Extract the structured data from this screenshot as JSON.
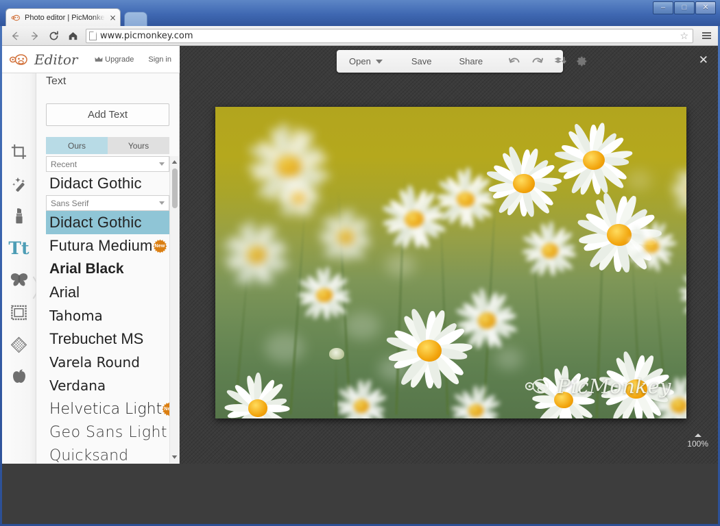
{
  "browser": {
    "tab_title": "Photo editor | PicMonkey: Fr",
    "tab_close": "×",
    "url": "www.picmonkey.com",
    "window_minimize": "–",
    "window_maximize": "□",
    "window_close": "✕",
    "back_icon": "←",
    "forward_icon": "→",
    "reload_icon": "⟳",
    "home_icon": "⌂",
    "star_icon": "☆",
    "menu_icon": "hamburger-icon"
  },
  "app_header": {
    "logo_text": "Editor",
    "upgrade_label": "Upgrade",
    "signin_label": "Sign in",
    "crown_icon": "crown-icon"
  },
  "rail": {
    "items": [
      {
        "name": "crop",
        "icon": "crop-icon",
        "active": false
      },
      {
        "name": "touch-up-effects",
        "icon": "magic-wand-icon",
        "active": false
      },
      {
        "name": "touch-up",
        "icon": "lipstick-icon",
        "active": false
      },
      {
        "name": "text",
        "icon": "text-tt-icon",
        "active": true
      },
      {
        "name": "overlays",
        "icon": "butterfly-icon",
        "active": false
      },
      {
        "name": "frames",
        "icon": "frame-icon",
        "active": false
      },
      {
        "name": "textures",
        "icon": "texture-icon",
        "active": false
      },
      {
        "name": "themes",
        "icon": "apple-icon",
        "active": false
      }
    ],
    "collapse_icon": "chevron-right-icon"
  },
  "panel": {
    "title": "Text",
    "add_text_label": "Add Text",
    "tabs": [
      {
        "label": "Ours",
        "active": true
      },
      {
        "label": "Yours",
        "active": false
      }
    ],
    "group_recent": "Recent",
    "group_sans_serif": "Sans Serif",
    "recent_fonts": [
      {
        "label": "Didact Gothic",
        "badge": null,
        "selected": false
      }
    ],
    "fonts": [
      {
        "label": "Didact Gothic",
        "badge": null,
        "selected": true
      },
      {
        "label": "Futura Medium",
        "badge": "New",
        "selected": false
      },
      {
        "label": "Arial Black",
        "badge": null,
        "selected": false
      },
      {
        "label": "Arial",
        "badge": null,
        "selected": false
      },
      {
        "label": "Tahoma",
        "badge": null,
        "selected": false
      },
      {
        "label": "Trebuchet MS",
        "badge": null,
        "selected": false
      },
      {
        "label": "Varela Round",
        "badge": null,
        "selected": false
      },
      {
        "label": "Verdana",
        "badge": null,
        "selected": false
      },
      {
        "label": "Helvetica Light",
        "badge": "New",
        "selected": false
      },
      {
        "label": "Geo Sans Light",
        "badge": null,
        "selected": false
      },
      {
        "label": "Quicksand",
        "badge": null,
        "selected": false
      }
    ]
  },
  "toolbar": {
    "open_label": "Open",
    "save_label": "Save",
    "share_label": "Share",
    "undo_icon": "undo-arrow-icon",
    "redo_icon": "redo-arrow-icon",
    "flatten_icon": "layers-download-icon",
    "settings_icon": "gear-icon",
    "open_caret": "chevron-down-icon"
  },
  "canvas": {
    "close_label": "✕",
    "zoom_level": "100%",
    "zoom_caret": "triangle-up-icon",
    "watermark_text": "PicMonkey",
    "watermark_icon": "monkey-face-icon"
  },
  "colors": {
    "accent_teal": "#4d9db5",
    "tab_active": "#b8dbe6",
    "font_selected": "#8fc5d6",
    "badge_orange": "#db7f12",
    "canvas_bg": "#3b3b3b",
    "window_blue": "#3f68b2"
  }
}
